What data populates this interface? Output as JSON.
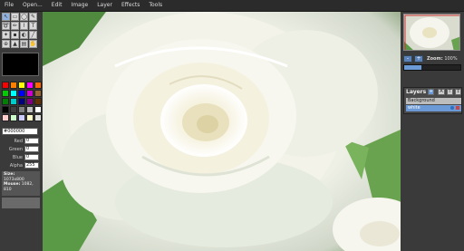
{
  "menu": [
    "File",
    "Open...",
    "Edit",
    "Image",
    "Layer",
    "Effects",
    "Tools"
  ],
  "tools": [
    {
      "icon": "select-arrow-icon",
      "glyph": "↖"
    },
    {
      "icon": "rect-select-icon",
      "glyph": "▭"
    },
    {
      "icon": "ellipse-select-icon",
      "glyph": "◯"
    },
    {
      "icon": "brush-icon",
      "glyph": "✎"
    },
    {
      "icon": "lasso-icon",
      "glyph": "➰"
    },
    {
      "icon": "pencil-icon",
      "glyph": "✏"
    },
    {
      "icon": "eyedropper-icon",
      "glyph": "⌇"
    },
    {
      "icon": "text-icon",
      "glyph": "T"
    },
    {
      "icon": "magic-wand-icon",
      "glyph": "✦"
    },
    {
      "icon": "eraser-icon",
      "glyph": "▪"
    },
    {
      "icon": "bucket-icon",
      "glyph": "◐"
    },
    {
      "icon": "line-icon",
      "glyph": "╱"
    },
    {
      "icon": "clone-icon",
      "glyph": "⊕"
    },
    {
      "icon": "shape-icon",
      "glyph": "▲"
    },
    {
      "icon": "gradient-icon",
      "glyph": "▤"
    },
    {
      "icon": "hand-icon",
      "glyph": "✋"
    }
  ],
  "palette": [
    "#ff0000",
    "#ff8000",
    "#ffff00",
    "#ff00ff",
    "#ff6600",
    "#00cc00",
    "#00ffff",
    "#0000ff",
    "#cc00cc",
    "#996633",
    "#008000",
    "#00cccc",
    "#000080",
    "#800080",
    "#663300",
    "#000000",
    "#404040",
    "#808080",
    "#c0c0c0",
    "#ffffff",
    "#ffcccc",
    "#ccffcc",
    "#ccccff",
    "#ffffcc",
    "#e0e0e0"
  ],
  "color": {
    "hex": "#000000",
    "red_label": "Red",
    "red": "0",
    "green_label": "Green",
    "green": "0",
    "blue_label": "Blue",
    "blue": "0",
    "alpha_label": "Alpha",
    "alpha": "255"
  },
  "info": {
    "size_label": "Size:",
    "size_value": "1073x800",
    "mouse_label": "Mouse:",
    "mouse_value": "1082, 810"
  },
  "zoom": {
    "label": "Zoom:",
    "value": "100%",
    "minus": "-",
    "plus": "+",
    "level_fraction": 0.3
  },
  "layers": {
    "title": "Layers",
    "add": "+",
    "buttons": [
      "A",
      "T",
      "↕"
    ],
    "items": [
      {
        "name": "Background"
      },
      {
        "name": "white"
      }
    ]
  }
}
